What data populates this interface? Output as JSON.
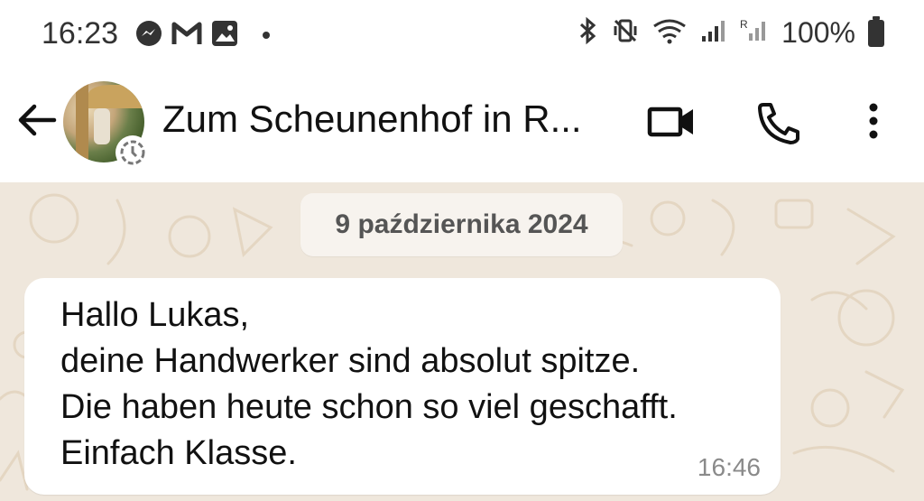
{
  "status_bar": {
    "time": "16:23",
    "left_icons": [
      "messenger-icon",
      "gmail-icon",
      "gallery-icon",
      "dot-icon"
    ],
    "right_icons": [
      "bluetooth-icon",
      "vibrate-off-icon",
      "wifi-icon",
      "signal-icon",
      "roaming-signal-icon"
    ],
    "battery_text": "100%"
  },
  "header": {
    "title": "Zum Scheunenhof in R...",
    "actions": [
      "video-call-icon",
      "phone-call-icon",
      "more-options-icon"
    ]
  },
  "chat": {
    "date_chip": "9 października 2024",
    "message": {
      "lines": [
        "Hallo Lukas,",
        "deine Handwerker sind absolut spitze.",
        "Die haben heute schon so viel geschafft.",
        "Einfach Klasse."
      ],
      "time": "16:46"
    }
  },
  "colors": {
    "wallpaper": "#efe7dc",
    "bubble": "#ffffff",
    "date_chip": "#f7f3ee",
    "text": "#111111",
    "meta_text": "#8a8a8a"
  }
}
